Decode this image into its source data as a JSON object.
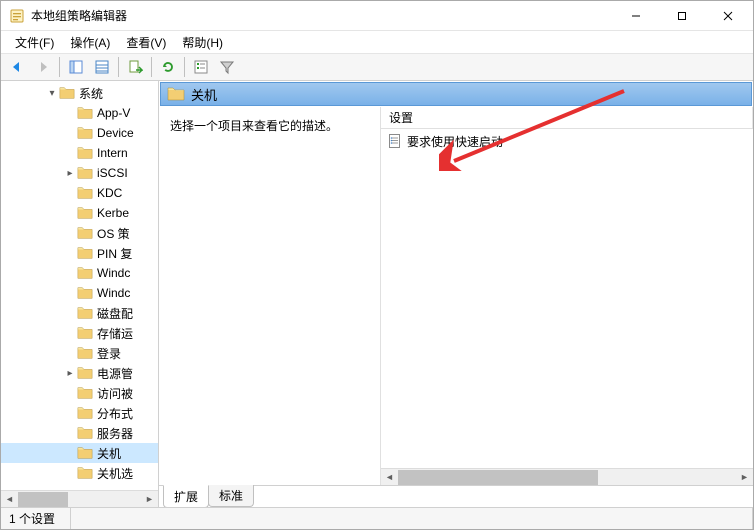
{
  "window": {
    "title": "本地组策略编辑器"
  },
  "menus": {
    "file": "文件(F)",
    "action": "操作(A)",
    "view": "查看(V)",
    "help": "帮助(H)"
  },
  "tree": {
    "root_label": "系统",
    "items": [
      {
        "label": "App-V"
      },
      {
        "label": "Device"
      },
      {
        "label": "Intern"
      },
      {
        "label": "iSCSI"
      },
      {
        "label": "KDC"
      },
      {
        "label": "Kerbe"
      },
      {
        "label": "OS 策"
      },
      {
        "label": "PIN 复"
      },
      {
        "label": "Windc"
      },
      {
        "label": "Windc"
      },
      {
        "label": "磁盘配"
      },
      {
        "label": "存储运"
      },
      {
        "label": "登录"
      },
      {
        "label": "电源管"
      },
      {
        "label": "访问被"
      },
      {
        "label": "分布式"
      },
      {
        "label": "服务器"
      },
      {
        "label": "关机",
        "selected": true
      },
      {
        "label": "关机选"
      }
    ]
  },
  "right": {
    "header": "关机",
    "description": "选择一个项目来查看它的描述。",
    "column_setting": "设置",
    "items": [
      {
        "label": "要求使用快速启动"
      }
    ]
  },
  "tabs": {
    "extended": "扩展",
    "standard": "标准"
  },
  "status": {
    "count": "1 个设置"
  }
}
